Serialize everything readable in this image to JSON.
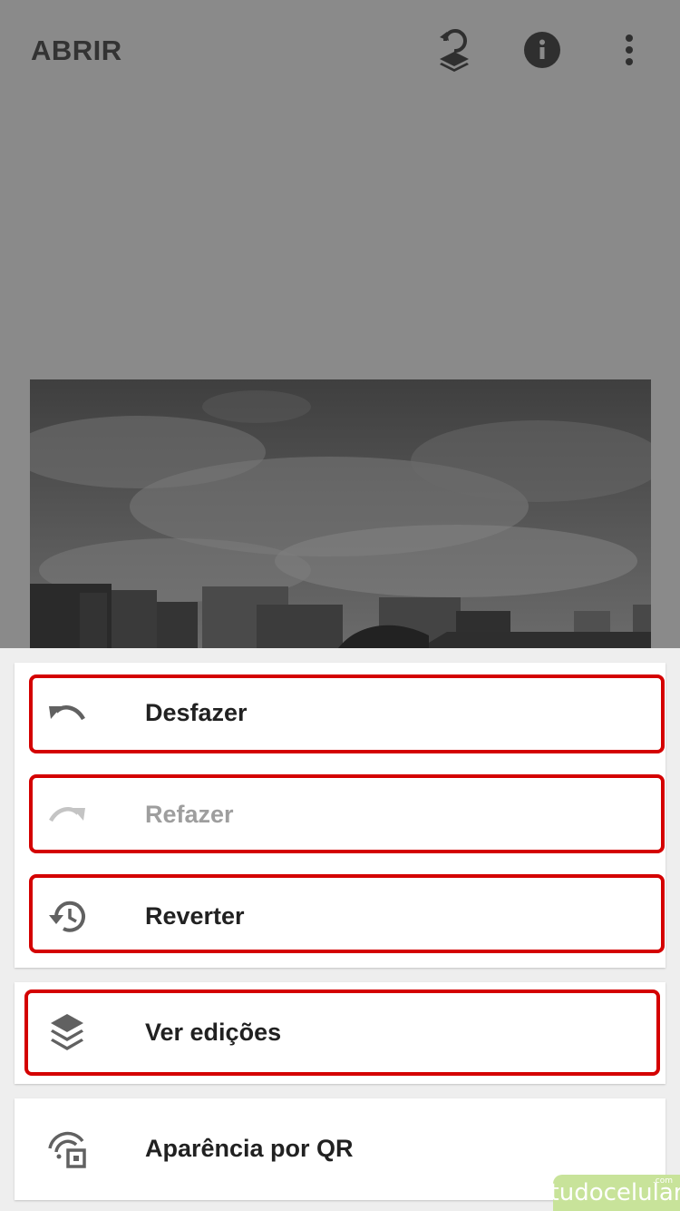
{
  "appbar": {
    "title": "ABRIR",
    "icons": [
      "layers-revert-icon",
      "info-icon",
      "more-vert-icon"
    ]
  },
  "menu": {
    "items": [
      {
        "label": "Desfazer",
        "icon": "undo-icon",
        "enabled": true
      },
      {
        "label": "Refazer",
        "icon": "redo-icon",
        "enabled": false
      },
      {
        "label": "Reverter",
        "icon": "history-icon",
        "enabled": true
      },
      {
        "label": "Ver edições",
        "icon": "layers-icon",
        "enabled": true
      },
      {
        "label": "Aparência por QR",
        "icon": "qr-look-icon",
        "enabled": true
      }
    ]
  },
  "colors": {
    "highlight": "#d40000",
    "text": "#212121",
    "disabled_text": "#9e9e9e",
    "overlay": "#8a8a8a"
  },
  "watermark": {
    "text": "tudocelular",
    "suffix": ".com"
  }
}
